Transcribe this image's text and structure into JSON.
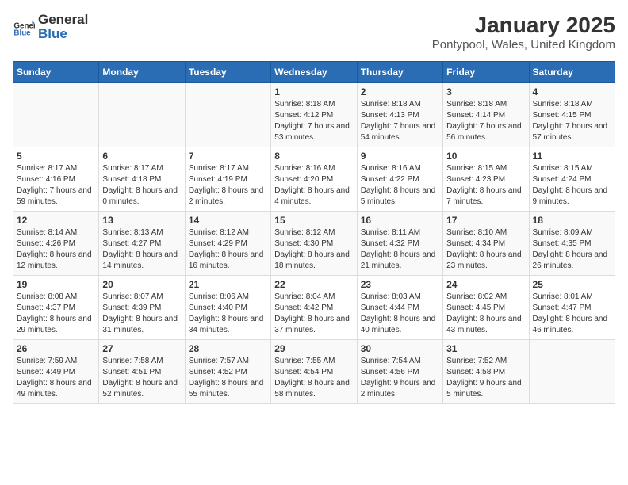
{
  "header": {
    "logo_general": "General",
    "logo_blue": "Blue",
    "title": "January 2025",
    "subtitle": "Pontypool, Wales, United Kingdom"
  },
  "weekdays": [
    "Sunday",
    "Monday",
    "Tuesday",
    "Wednesday",
    "Thursday",
    "Friday",
    "Saturday"
  ],
  "weeks": [
    [
      {
        "day": "",
        "info": ""
      },
      {
        "day": "",
        "info": ""
      },
      {
        "day": "",
        "info": ""
      },
      {
        "day": "1",
        "info": "Sunrise: 8:18 AM\nSunset: 4:12 PM\nDaylight: 7 hours and 53 minutes."
      },
      {
        "day": "2",
        "info": "Sunrise: 8:18 AM\nSunset: 4:13 PM\nDaylight: 7 hours and 54 minutes."
      },
      {
        "day": "3",
        "info": "Sunrise: 8:18 AM\nSunset: 4:14 PM\nDaylight: 7 hours and 56 minutes."
      },
      {
        "day": "4",
        "info": "Sunrise: 8:18 AM\nSunset: 4:15 PM\nDaylight: 7 hours and 57 minutes."
      }
    ],
    [
      {
        "day": "5",
        "info": "Sunrise: 8:17 AM\nSunset: 4:16 PM\nDaylight: 7 hours and 59 minutes."
      },
      {
        "day": "6",
        "info": "Sunrise: 8:17 AM\nSunset: 4:18 PM\nDaylight: 8 hours and 0 minutes."
      },
      {
        "day": "7",
        "info": "Sunrise: 8:17 AM\nSunset: 4:19 PM\nDaylight: 8 hours and 2 minutes."
      },
      {
        "day": "8",
        "info": "Sunrise: 8:16 AM\nSunset: 4:20 PM\nDaylight: 8 hours and 4 minutes."
      },
      {
        "day": "9",
        "info": "Sunrise: 8:16 AM\nSunset: 4:22 PM\nDaylight: 8 hours and 5 minutes."
      },
      {
        "day": "10",
        "info": "Sunrise: 8:15 AM\nSunset: 4:23 PM\nDaylight: 8 hours and 7 minutes."
      },
      {
        "day": "11",
        "info": "Sunrise: 8:15 AM\nSunset: 4:24 PM\nDaylight: 8 hours and 9 minutes."
      }
    ],
    [
      {
        "day": "12",
        "info": "Sunrise: 8:14 AM\nSunset: 4:26 PM\nDaylight: 8 hours and 12 minutes."
      },
      {
        "day": "13",
        "info": "Sunrise: 8:13 AM\nSunset: 4:27 PM\nDaylight: 8 hours and 14 minutes."
      },
      {
        "day": "14",
        "info": "Sunrise: 8:12 AM\nSunset: 4:29 PM\nDaylight: 8 hours and 16 minutes."
      },
      {
        "day": "15",
        "info": "Sunrise: 8:12 AM\nSunset: 4:30 PM\nDaylight: 8 hours and 18 minutes."
      },
      {
        "day": "16",
        "info": "Sunrise: 8:11 AM\nSunset: 4:32 PM\nDaylight: 8 hours and 21 minutes."
      },
      {
        "day": "17",
        "info": "Sunrise: 8:10 AM\nSunset: 4:34 PM\nDaylight: 8 hours and 23 minutes."
      },
      {
        "day": "18",
        "info": "Sunrise: 8:09 AM\nSunset: 4:35 PM\nDaylight: 8 hours and 26 minutes."
      }
    ],
    [
      {
        "day": "19",
        "info": "Sunrise: 8:08 AM\nSunset: 4:37 PM\nDaylight: 8 hours and 29 minutes."
      },
      {
        "day": "20",
        "info": "Sunrise: 8:07 AM\nSunset: 4:39 PM\nDaylight: 8 hours and 31 minutes."
      },
      {
        "day": "21",
        "info": "Sunrise: 8:06 AM\nSunset: 4:40 PM\nDaylight: 8 hours and 34 minutes."
      },
      {
        "day": "22",
        "info": "Sunrise: 8:04 AM\nSunset: 4:42 PM\nDaylight: 8 hours and 37 minutes."
      },
      {
        "day": "23",
        "info": "Sunrise: 8:03 AM\nSunset: 4:44 PM\nDaylight: 8 hours and 40 minutes."
      },
      {
        "day": "24",
        "info": "Sunrise: 8:02 AM\nSunset: 4:45 PM\nDaylight: 8 hours and 43 minutes."
      },
      {
        "day": "25",
        "info": "Sunrise: 8:01 AM\nSunset: 4:47 PM\nDaylight: 8 hours and 46 minutes."
      }
    ],
    [
      {
        "day": "26",
        "info": "Sunrise: 7:59 AM\nSunset: 4:49 PM\nDaylight: 8 hours and 49 minutes."
      },
      {
        "day": "27",
        "info": "Sunrise: 7:58 AM\nSunset: 4:51 PM\nDaylight: 8 hours and 52 minutes."
      },
      {
        "day": "28",
        "info": "Sunrise: 7:57 AM\nSunset: 4:52 PM\nDaylight: 8 hours and 55 minutes."
      },
      {
        "day": "29",
        "info": "Sunrise: 7:55 AM\nSunset: 4:54 PM\nDaylight: 8 hours and 58 minutes."
      },
      {
        "day": "30",
        "info": "Sunrise: 7:54 AM\nSunset: 4:56 PM\nDaylight: 9 hours and 2 minutes."
      },
      {
        "day": "31",
        "info": "Sunrise: 7:52 AM\nSunset: 4:58 PM\nDaylight: 9 hours and 5 minutes."
      },
      {
        "day": "",
        "info": ""
      }
    ]
  ]
}
